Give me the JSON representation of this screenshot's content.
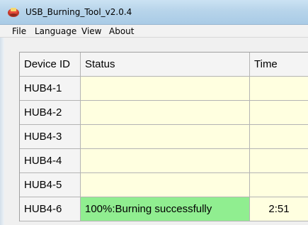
{
  "window": {
    "title": "USB_Burning_Tool_v2.0.4"
  },
  "menu": [
    "File",
    "Language",
    "View",
    "About"
  ],
  "table": {
    "columns": [
      "Device ID",
      "Status",
      "Time"
    ],
    "rows": [
      {
        "id": "HUB4-1",
        "status": "",
        "time": "",
        "state": "idle"
      },
      {
        "id": "HUB4-2",
        "status": "",
        "time": "",
        "state": "idle"
      },
      {
        "id": "HUB4-3",
        "status": "",
        "time": "",
        "state": "idle"
      },
      {
        "id": "HUB4-4",
        "status": "",
        "time": "",
        "state": "idle"
      },
      {
        "id": "HUB4-5",
        "status": "",
        "time": "",
        "state": "idle"
      },
      {
        "id": "HUB4-6",
        "status": "100%:Burning successfully",
        "time": "2:51",
        "state": "success"
      }
    ]
  },
  "colors": {
    "idle_cell": "#ffffe0",
    "success_cell": "#90ee90",
    "titlebar": "#b7d4ea"
  },
  "icons": {
    "app": "usb-burning-tool-icon"
  }
}
